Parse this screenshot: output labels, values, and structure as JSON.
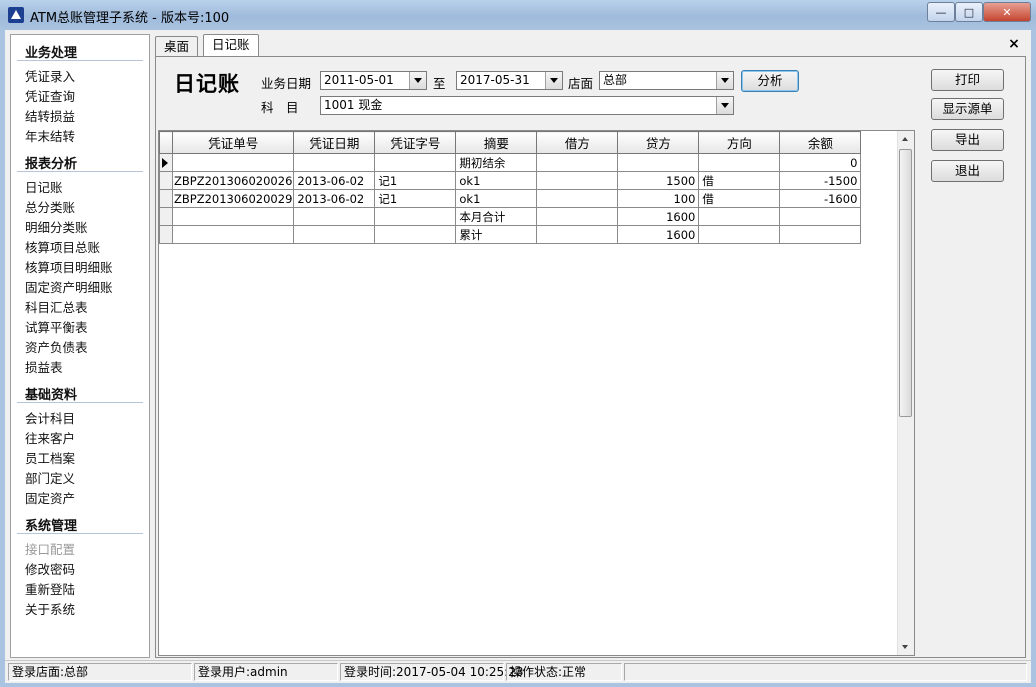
{
  "window": {
    "title": "ATM总账管理子系统 - 版本号:100",
    "buttons": {
      "minimize": "—",
      "maximize": "□",
      "close": "✕"
    }
  },
  "sidebar": {
    "sections": [
      {
        "title": "业务处理",
        "items": [
          {
            "label": "凭证录入"
          },
          {
            "label": "凭证查询"
          },
          {
            "label": "结转损益"
          },
          {
            "label": "年末结转"
          }
        ]
      },
      {
        "title": "报表分析",
        "items": [
          {
            "label": "日记账"
          },
          {
            "label": "总分类账"
          },
          {
            "label": "明细分类账"
          },
          {
            "label": "核算项目总账"
          },
          {
            "label": "核算项目明细账"
          },
          {
            "label": "固定资产明细账"
          },
          {
            "label": "科目汇总表"
          },
          {
            "label": "试算平衡表"
          },
          {
            "label": "资产负债表"
          },
          {
            "label": "损益表"
          }
        ]
      },
      {
        "title": "基础资料",
        "items": [
          {
            "label": "会计科目"
          },
          {
            "label": "往来客户"
          },
          {
            "label": "员工档案"
          },
          {
            "label": "部门定义"
          },
          {
            "label": "固定资产"
          }
        ]
      },
      {
        "title": "系统管理",
        "items": [
          {
            "label": "接口配置",
            "disabled": true
          },
          {
            "label": "修改密码"
          },
          {
            "label": "重新登陆"
          },
          {
            "label": "关于系统"
          }
        ]
      }
    ]
  },
  "tabs": [
    {
      "label": "桌面"
    },
    {
      "label": "日记账",
      "active": true
    }
  ],
  "panel_close": "×",
  "form": {
    "title": "日记账",
    "date_label": "业务日期",
    "date_from": "2011-05-01",
    "to_label": "至",
    "date_to": "2017-05-31",
    "store_label": "店面",
    "store_value": "总部",
    "account_label": "科　目",
    "account_value": "1001 现金",
    "analyze_button": "分析"
  },
  "actions": {
    "print": "打印",
    "show_source": "显示源单",
    "export": "导出",
    "exit": "退出"
  },
  "table": {
    "columns": [
      "凭证单号",
      "凭证日期",
      "凭证字号",
      "摘要",
      "借方",
      "贷方",
      "方向",
      "余额"
    ],
    "rows": [
      {
        "voucher_no": "",
        "date": "",
        "word_no": "",
        "summary": "期初结余",
        "debit": "",
        "credit": "",
        "direction": "",
        "balance": "0",
        "current": true
      },
      {
        "voucher_no": "ZBPZ201306020026",
        "date": "2013-06-02",
        "word_no": "记1",
        "summary": "ok1",
        "debit": "",
        "credit": "1500",
        "direction": "借",
        "balance": "-1500"
      },
      {
        "voucher_no": "ZBPZ201306020029",
        "date": "2013-06-02",
        "word_no": "记1",
        "summary": "ok1",
        "debit": "",
        "credit": "100",
        "direction": "借",
        "balance": "-1600"
      },
      {
        "voucher_no": "",
        "date": "",
        "word_no": "",
        "summary": "本月合计",
        "debit": "",
        "credit": "1600",
        "direction": "",
        "balance": ""
      },
      {
        "voucher_no": "",
        "date": "",
        "word_no": "",
        "summary": "累计",
        "debit": "",
        "credit": "1600",
        "direction": "",
        "balance": ""
      }
    ]
  },
  "status_bar": {
    "store": "登录店面:总部",
    "user": "登录用户:admin",
    "login_time": "登录时间:2017-05-04 10:25:23",
    "operation": "操作状态:正常"
  }
}
